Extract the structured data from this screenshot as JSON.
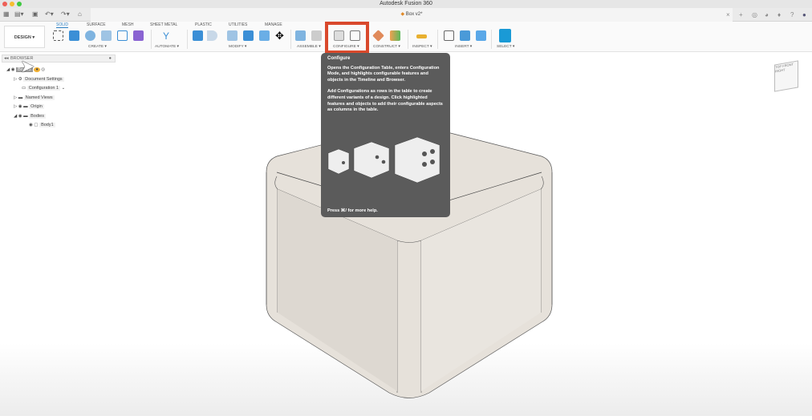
{
  "app_title": "Autodesk Fusion 360",
  "document_tab": "Box v2*",
  "workspace": "DESIGN ▾",
  "tabs": [
    "SOLID",
    "SURFACE",
    "MESH",
    "SHEET METAL",
    "PLASTIC",
    "UTILITIES",
    "MANAGE"
  ],
  "groups": {
    "create": "CREATE ▾",
    "automate": "AUTOMATE ▾",
    "modify": "MODIFY ▾",
    "assemble": "ASSEMBLE ▾",
    "configure": "CONFIGURE ▾",
    "construct": "CONSTRUCT ▾",
    "inspect": "INSPECT ▾",
    "insert": "INSERT ▾",
    "select": "SELECT ▾"
  },
  "browser": {
    "title": "BROWSER",
    "items": [
      "Box v2",
      "Document Settings",
      "Configuration 1",
      "Named Views",
      "Origin",
      "Bodies",
      "Body1"
    ]
  },
  "tooltip": {
    "title": "Configure",
    "p1": "Opens the Configuration Table, enters Configuration Mode, and highlights configurable features and objects in the Timeline and Browser.",
    "p2": "Add Configurations as rows in the table to create different variants of a design. Click highlighted features and objects to add their configurable aspects as columns in the table.",
    "footer": "Press ⌘/ for more help."
  },
  "viewcube": {
    "top": "TOP",
    "front": "FRONT",
    "right": "RIGHT"
  },
  "colors": {
    "accent": "#2c7fc1",
    "highlight": "#d9492c",
    "tooltip": "#5b5b5b"
  }
}
